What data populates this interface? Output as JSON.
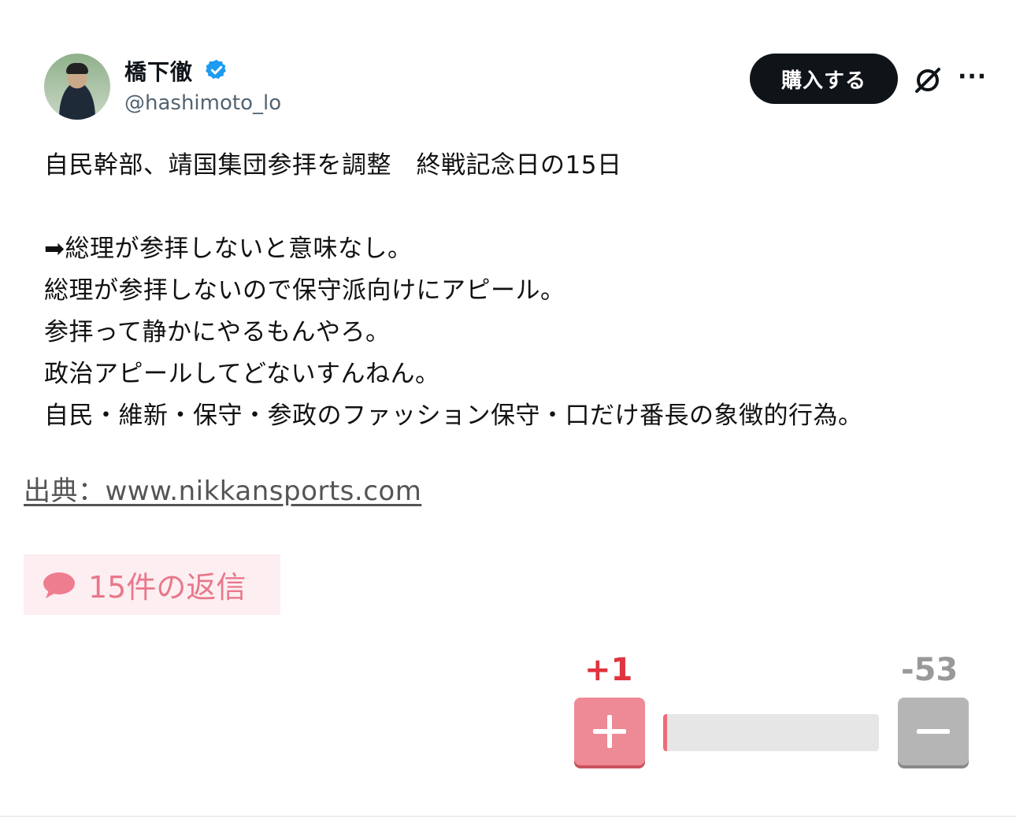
{
  "post": {
    "author_name": "橋下徹",
    "handle": "@hashimoto_lo",
    "buy_button_label": "購入する",
    "more_label": "···",
    "lines": [
      "自民幹部、靖国集団参拝を調整　終戦記念日の15日",
      "",
      "➡総理が参拝しないと意味なし。",
      "総理が参拝しないので保守派向けにアピール。",
      "参拝って静かにやるもんやろ。",
      "政治アピールしてどないすんねん。",
      "自民・維新・保守・参政のファッション保守・口だけ番長の象徴的行為。"
    ]
  },
  "source": {
    "text": "出典：www.nikkansports.com"
  },
  "replies": {
    "label": "15件の返信"
  },
  "vote": {
    "plus_label": "+1",
    "minus_label": "-53",
    "plus_fraction": 0.018
  },
  "colors": {
    "accent_pink": "#ee8a95",
    "verified_blue": "#1d9bf0",
    "plus_text": "#e0343f",
    "minus_gray": "#999999"
  }
}
